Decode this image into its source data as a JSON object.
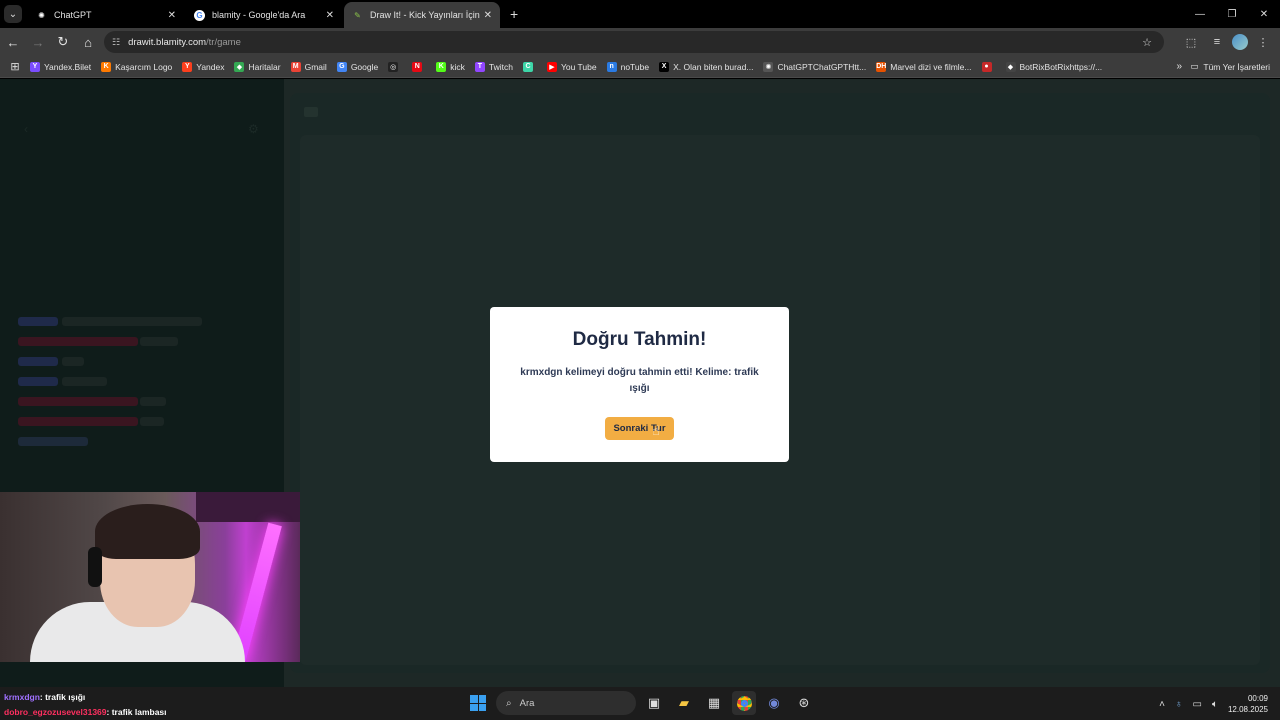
{
  "tabs": [
    {
      "title": "ChatGPT",
      "favicon_color": "#ffffff"
    },
    {
      "title": "blamity - Google'da Ara",
      "favicon_color": "#ffffff"
    },
    {
      "title": "Draw It! - Kick Yayınları İçin Çiz",
      "favicon_color": "#8bc34a"
    }
  ],
  "url": {
    "host": "drawit.blamity.com",
    "path": "/tr/game"
  },
  "bookmarks": [
    {
      "label": "Yandex.Bilet",
      "color": "#7b4dff",
      "glyph": "Y"
    },
    {
      "label": "Kaşarcım Logo",
      "color": "#ff7a00",
      "glyph": "K"
    },
    {
      "label": "Yandex",
      "color": "#fc3f1d",
      "glyph": "Y"
    },
    {
      "label": "Haritalar",
      "color": "#34a853",
      "glyph": "◆"
    },
    {
      "label": "Gmail",
      "color": "#ea4335",
      "glyph": "M"
    },
    {
      "label": "Google",
      "color": "#4285f4",
      "glyph": "G"
    },
    {
      "label": "",
      "color": "#222222",
      "glyph": "◎"
    },
    {
      "label": "",
      "color": "#e50914",
      "glyph": "N"
    },
    {
      "label": "kick",
      "color": "#53fc18",
      "glyph": "K"
    },
    {
      "label": "Twitch",
      "color": "#9146ff",
      "glyph": "T"
    },
    {
      "label": "",
      "color": "#3dd6a8",
      "glyph": "C"
    },
    {
      "label": "You Tube",
      "color": "#ff0000",
      "glyph": "▶"
    },
    {
      "label": "noTube",
      "color": "#2a7ae2",
      "glyph": "n"
    },
    {
      "label": "X. Olan biten burad...",
      "color": "#000000",
      "glyph": "X"
    },
    {
      "label": "ChatGPTChatGPTHtt...",
      "color": "#555555",
      "glyph": "✺"
    },
    {
      "label": "Marvel dizi ve filmle...",
      "color": "#e65100",
      "glyph": "DH"
    },
    {
      "label": "",
      "color": "#c62828",
      "glyph": "●"
    },
    {
      "label": "BotRixBotRixhttps://...",
      "color": "#444444",
      "glyph": "◆"
    }
  ],
  "bookmarks_all": "Tüm Yer İşaretleri",
  "modal": {
    "title": "Doğru Tahmin!",
    "message": "krmxdgn kelimeyi doğru tahmin etti! Kelime: trafik ışığı",
    "button": "Sonraki Tur"
  },
  "stream_chat": [
    {
      "user": "krmxdgn",
      "text": ": trafik ışığı"
    },
    {
      "user": "dobro_egzozusevel31369",
      "text": ": trafik lambası"
    }
  ],
  "taskbar": {
    "search_placeholder": "Ara",
    "time": "00:09",
    "date": "12.08.2025"
  }
}
